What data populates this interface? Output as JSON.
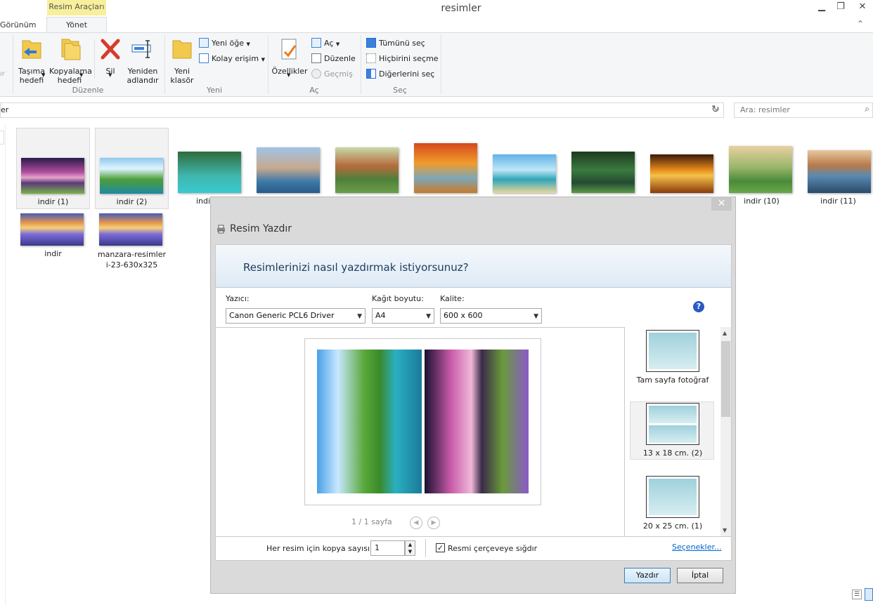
{
  "window": {
    "title": "resimler",
    "context_tab_header": "Resim Araçları"
  },
  "tabs": [
    {
      "label": "Görünüm"
    },
    {
      "label": "Yönet"
    }
  ],
  "ribbon": {
    "duzenle": {
      "label": "Düzenle",
      "move": "Taşıma\nhedefi",
      "copy": "Kopyalama\nhedefi",
      "delete": "Sil",
      "rename": "Yeniden\nadlandır"
    },
    "yeni": {
      "label": "Yeni",
      "new_folder": "Yeni\nklasör",
      "new_item": "Yeni öğe",
      "easy_access": "Kolay erişim"
    },
    "ac": {
      "label": "Aç",
      "properties": "Özellikler",
      "open": "Aç",
      "edit": "Düzenle",
      "history": "Geçmiş"
    },
    "sec": {
      "label": "Seç",
      "select_all": "Tümünü seç",
      "select_none": "Hiçbirini seçme",
      "invert": "Diğerlerini seç"
    }
  },
  "address": {
    "path": "er",
    "search_placeholder": "Ara: resimler"
  },
  "files": [
    {
      "name": "indir (1)"
    },
    {
      "name": "indir (2)"
    },
    {
      "name": "indi"
    },
    {
      "name": "indir (10)"
    },
    {
      "name": "indir (11)"
    },
    {
      "name": "indir"
    },
    {
      "name": "manzara-resimler\ni-23-630x325"
    }
  ],
  "dialog": {
    "title": "Resim Yazdır",
    "question": "Resimlerinizi nasıl yazdırmak istiyorsunuz?",
    "printer_label": "Yazıcı:",
    "printer_value": "Canon Generic PCL6 Driver",
    "paper_label": "Kağıt boyutu:",
    "paper_value": "A4",
    "quality_label": "Kalite:",
    "quality_value": "600 x 600",
    "page_indicator": "1 / 1 sayfa",
    "layouts": [
      {
        "label": "Tam sayfa fotoğraf"
      },
      {
        "label": "13 x 18 cm. (2)"
      },
      {
        "label": "20 x 25 cm. (1)"
      }
    ],
    "copies_label": "Her resim için kopya sayısı:",
    "copies_value": "1",
    "fit_label": "Resmi çerçeveye sığdır",
    "fit_checked": true,
    "options_link": "Seçenekler...",
    "print_button": "Yazdır",
    "cancel_button": "İptal"
  }
}
